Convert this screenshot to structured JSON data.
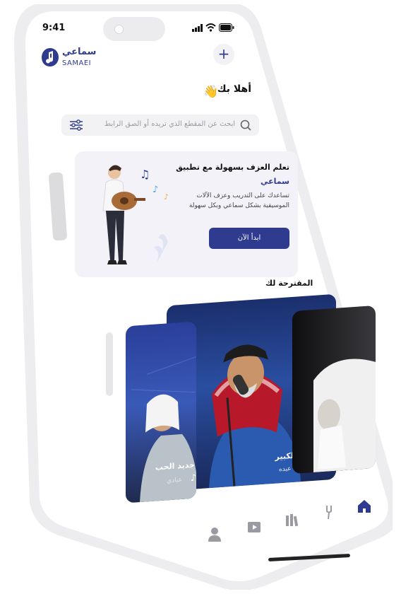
{
  "status": {
    "time": "9:41"
  },
  "header": {
    "logo_ar": "سماعي",
    "logo_en": "SAMAEI",
    "add_label": "+"
  },
  "greeting": {
    "text": "أهلا بك",
    "emoji": "👋"
  },
  "search": {
    "placeholder": "ابحث عن المقطع الذي تريده أو الصق الرابط"
  },
  "banner": {
    "title": "تعلم العزف بسهولة مع تطبيق",
    "brand": "سماعي",
    "description": "تساعدك على التدريب وعزف الآلات الموسيقية بشكل سماعي وبكل سهولة",
    "cta": "ابدأ الآن"
  },
  "suggested": {
    "heading": "المقترحة لك",
    "cards": [
      {
        "title": "الفرق الكبير",
        "artist": "محمد عبده"
      },
      {
        "title": "جديد الحب",
        "artist": "عبادي"
      }
    ]
  },
  "colors": {
    "accent": "#2f3b8f",
    "background": "#ffffff",
    "surface": "#f2f2f8"
  },
  "tabs": [
    "home-icon",
    "tuning-fork-icon",
    "library-icon",
    "video-icon",
    "profile-icon"
  ]
}
